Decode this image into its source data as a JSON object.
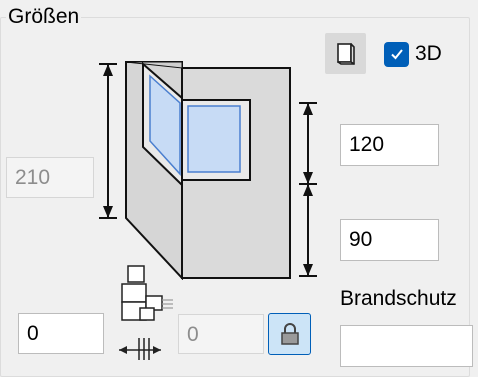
{
  "group": {
    "title": "Größen"
  },
  "view_toggle": {
    "icon": "box-view-icon"
  },
  "checkbox_3d": {
    "label": "3D",
    "checked": true,
    "color": "#005fb8"
  },
  "fields": {
    "total_height": {
      "value": "210",
      "disabled": true
    },
    "upper_height": {
      "value": "120",
      "disabled": false
    },
    "lower_height": {
      "value": "90",
      "disabled": false
    },
    "left_offset": {
      "value": "0",
      "disabled": false
    },
    "linked_offset": {
      "value": "0",
      "disabled": true
    },
    "brandschutz": {
      "value": "",
      "disabled": false
    }
  },
  "labels": {
    "brandschutz": "Brandschutz"
  },
  "lock": {
    "icon": "lock-icon",
    "active": true
  }
}
